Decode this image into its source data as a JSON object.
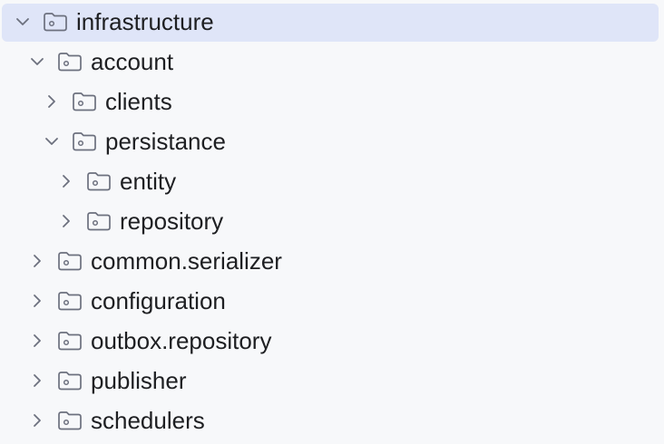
{
  "tree": {
    "nodes": [
      {
        "label": "infrastructure",
        "depth": 0,
        "expanded": true,
        "selected": true,
        "icon": "folder-icon"
      },
      {
        "label": "account",
        "depth": 1,
        "expanded": true,
        "selected": false,
        "icon": "folder-icon"
      },
      {
        "label": "clients",
        "depth": 2,
        "expanded": false,
        "selected": false,
        "icon": "folder-icon"
      },
      {
        "label": "persistance",
        "depth": 2,
        "expanded": true,
        "selected": false,
        "icon": "folder-icon"
      },
      {
        "label": "entity",
        "depth": 3,
        "expanded": false,
        "selected": false,
        "icon": "folder-icon"
      },
      {
        "label": "repository",
        "depth": 3,
        "expanded": false,
        "selected": false,
        "icon": "folder-icon"
      },
      {
        "label": "common.serializer",
        "depth": 1,
        "expanded": false,
        "selected": false,
        "icon": "folder-icon"
      },
      {
        "label": "configuration",
        "depth": 1,
        "expanded": false,
        "selected": false,
        "icon": "folder-icon"
      },
      {
        "label": "outbox.repository",
        "depth": 1,
        "expanded": false,
        "selected": false,
        "icon": "folder-icon"
      },
      {
        "label": "publisher",
        "depth": 1,
        "expanded": false,
        "selected": false,
        "icon": "folder-icon"
      },
      {
        "label": "schedulers",
        "depth": 1,
        "expanded": false,
        "selected": false,
        "icon": "folder-icon"
      }
    ]
  },
  "colors": {
    "background": "#f7f8fa",
    "selection": "#dfe5f8",
    "text": "#1e1f22",
    "icon": "#6c707e"
  }
}
